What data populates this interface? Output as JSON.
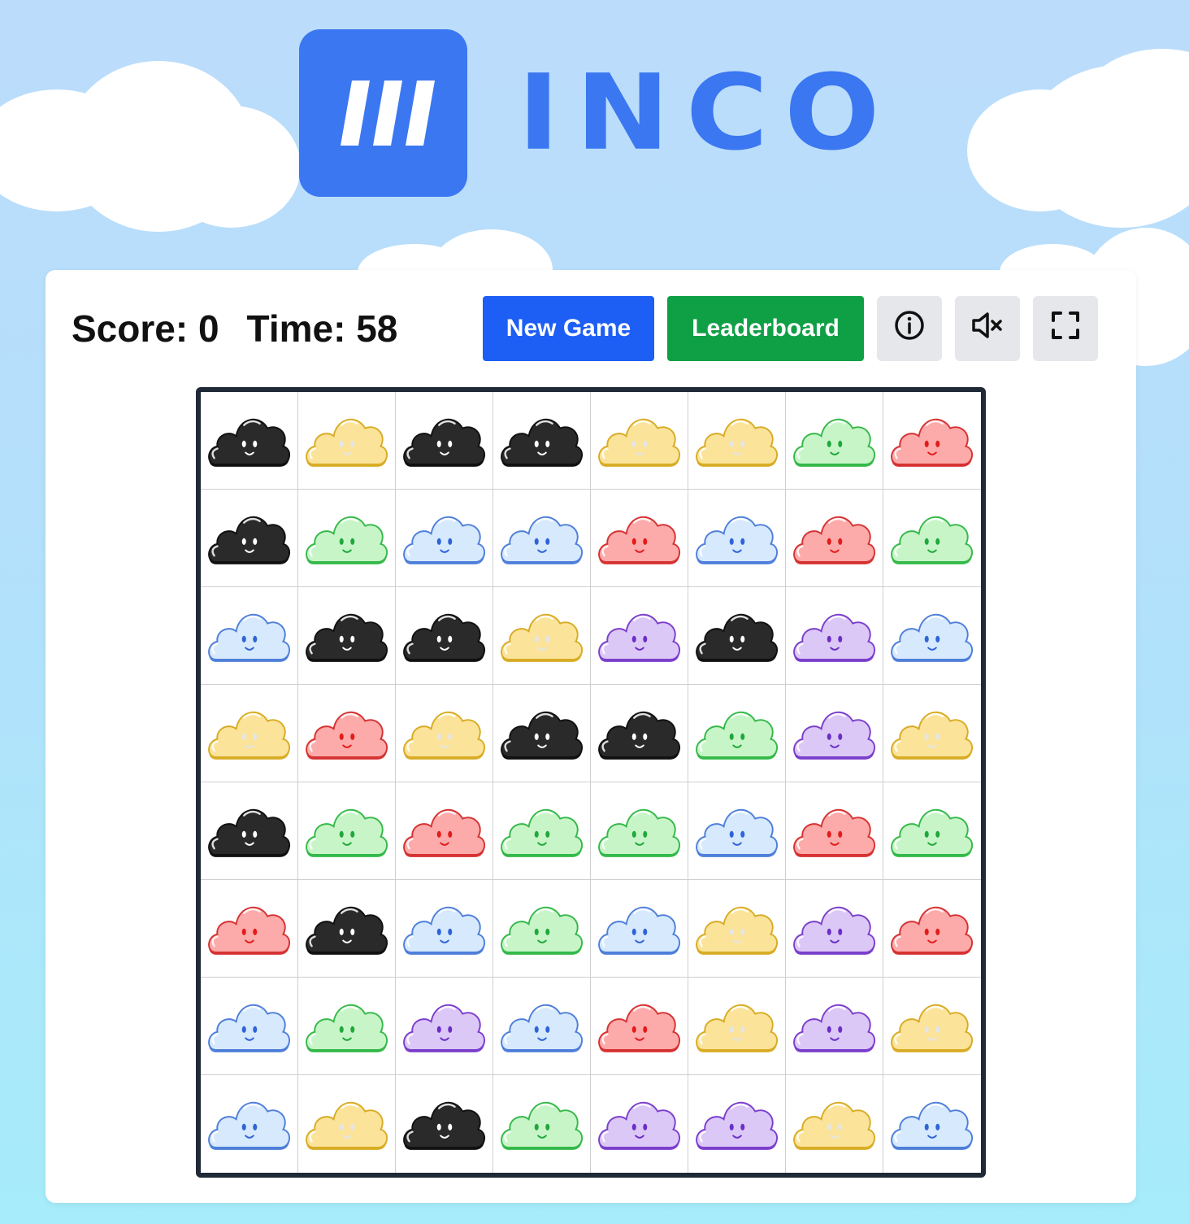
{
  "brand": {
    "name": "INCO",
    "mark_icon": "triple-slash-logo",
    "color": "#3b77f1"
  },
  "header": {
    "score_label": "Score:",
    "score_value": "0",
    "time_label": "Time:",
    "time_value": "58"
  },
  "buttons": {
    "new_game": {
      "label": "New Game",
      "color": "#1d5ef5"
    },
    "leaderboard": {
      "label": "Leaderboard",
      "color": "#0fa046"
    },
    "info": {
      "icon": "info-icon"
    },
    "sound": {
      "icon": "mute-icon"
    },
    "fullscreen": {
      "icon": "fullscreen-icon"
    }
  },
  "palette": {
    "black": {
      "fill": "#2a2a2a",
      "stroke": "#111111",
      "feature": "#ffffff"
    },
    "yellow": {
      "fill": "#fbe39a",
      "stroke": "#d8ac25",
      "feature": "#e5e5e5"
    },
    "green": {
      "fill": "#c8f5c8",
      "stroke": "#35b94a",
      "feature": "#1fa83b"
    },
    "red": {
      "fill": "#fcaaaa",
      "stroke": "#d63232",
      "feature": "#e31b1b"
    },
    "blue": {
      "fill": "#d6e9fd",
      "stroke": "#4f7fda",
      "feature": "#2f63d8"
    },
    "purple": {
      "fill": "#dcc8f6",
      "stroke": "#7b3fcc",
      "feature": "#6a2fc7"
    }
  },
  "board": {
    "rows": 8,
    "cols": 8,
    "grid": [
      [
        "black",
        "yellow",
        "black",
        "black",
        "yellow",
        "yellow",
        "green",
        "red"
      ],
      [
        "black",
        "green",
        "blue",
        "blue",
        "red",
        "blue",
        "red",
        "green"
      ],
      [
        "blue",
        "black",
        "black",
        "yellow",
        "purple",
        "black",
        "purple",
        "blue"
      ],
      [
        "yellow",
        "red",
        "yellow",
        "black",
        "black",
        "green",
        "purple",
        "yellow"
      ],
      [
        "black",
        "green",
        "red",
        "green",
        "green",
        "blue",
        "red",
        "green"
      ],
      [
        "red",
        "black",
        "blue",
        "green",
        "blue",
        "yellow",
        "purple",
        "red"
      ],
      [
        "blue",
        "green",
        "purple",
        "blue",
        "red",
        "yellow",
        "purple",
        "yellow"
      ],
      [
        "blue",
        "yellow",
        "black",
        "green",
        "purple",
        "purple",
        "yellow",
        "blue"
      ]
    ]
  }
}
